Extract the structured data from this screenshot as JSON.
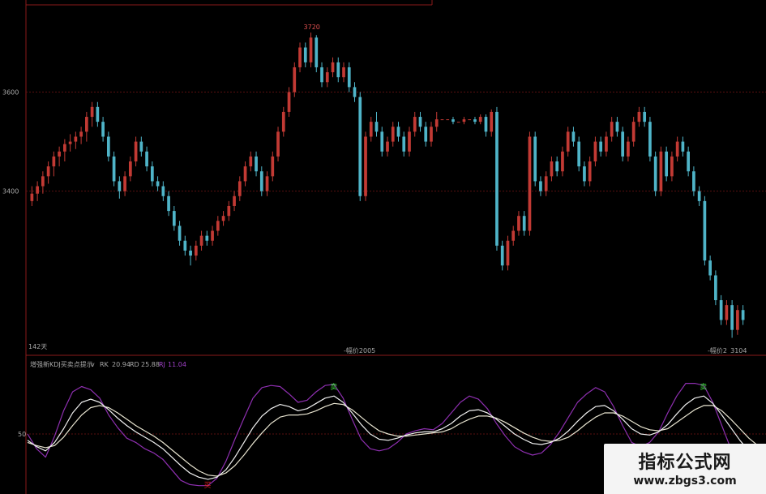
{
  "chart_data": [
    {
      "type": "candlestick",
      "y_ticks": [
        3400,
        3600
      ],
      "ylim": [
        3090,
        3740
      ],
      "high_label": "3720",
      "low_label": "3104",
      "left_label": "142天",
      "bottom_label": "-幅价2005",
      "bottom_right_label": "-幅价2",
      "candles": [
        [
          3380,
          3395,
          3370,
          3410
        ],
        [
          3395,
          3410,
          3380,
          3420
        ],
        [
          3410,
          3430,
          3395,
          3440
        ],
        [
          3430,
          3450,
          3415,
          3460
        ],
        [
          3450,
          3470,
          3430,
          3480
        ],
        [
          3470,
          3480,
          3450,
          3490
        ],
        [
          3480,
          3495,
          3460,
          3505
        ],
        [
          3495,
          3500,
          3480,
          3515
        ],
        [
          3500,
          3510,
          3485,
          3520
        ],
        [
          3510,
          3520,
          3495,
          3530
        ],
        [
          3520,
          3550,
          3500,
          3560
        ],
        [
          3550,
          3570,
          3530,
          3580
        ],
        [
          3570,
          3540,
          3530,
          3580
        ],
        [
          3540,
          3510,
          3500,
          3550
        ],
        [
          3510,
          3470,
          3460,
          3520
        ],
        [
          3470,
          3420,
          3410,
          3480
        ],
        [
          3420,
          3400,
          3385,
          3430
        ],
        [
          3400,
          3430,
          3390,
          3440
        ],
        [
          3430,
          3460,
          3420,
          3470
        ],
        [
          3460,
          3500,
          3450,
          3510
        ],
        [
          3500,
          3480,
          3470,
          3510
        ],
        [
          3480,
          3450,
          3440,
          3490
        ],
        [
          3450,
          3420,
          3410,
          3460
        ],
        [
          3420,
          3410,
          3400,
          3430
        ],
        [
          3410,
          3390,
          3380,
          3420
        ],
        [
          3390,
          3360,
          3350,
          3400
        ],
        [
          3360,
          3330,
          3320,
          3370
        ],
        [
          3330,
          3300,
          3290,
          3340
        ],
        [
          3300,
          3280,
          3270,
          3310
        ],
        [
          3280,
          3270,
          3250,
          3290
        ],
        [
          3270,
          3290,
          3260,
          3300
        ],
        [
          3290,
          3310,
          3280,
          3320
        ],
        [
          3310,
          3300,
          3290,
          3320
        ],
        [
          3300,
          3320,
          3290,
          3330
        ],
        [
          3320,
          3340,
          3310,
          3350
        ],
        [
          3340,
          3350,
          3330,
          3360
        ],
        [
          3350,
          3370,
          3340,
          3380
        ],
        [
          3370,
          3390,
          3360,
          3400
        ],
        [
          3390,
          3420,
          3380,
          3430
        ],
        [
          3420,
          3450,
          3410,
          3460
        ],
        [
          3450,
          3470,
          3440,
          3480
        ],
        [
          3470,
          3440,
          3430,
          3480
        ],
        [
          3440,
          3400,
          3390,
          3450
        ],
        [
          3400,
          3430,
          3390,
          3440
        ],
        [
          3430,
          3470,
          3420,
          3480
        ],
        [
          3470,
          3520,
          3460,
          3530
        ],
        [
          3520,
          3560,
          3510,
          3570
        ],
        [
          3560,
          3600,
          3550,
          3610
        ],
        [
          3600,
          3650,
          3590,
          3660
        ],
        [
          3650,
          3690,
          3640,
          3700
        ],
        [
          3690,
          3660,
          3650,
          3700
        ],
        [
          3660,
          3710,
          3650,
          3720
        ],
        [
          3710,
          3650,
          3640,
          3715
        ],
        [
          3650,
          3620,
          3610,
          3660
        ],
        [
          3620,
          3640,
          3610,
          3650
        ],
        [
          3640,
          3660,
          3630,
          3670
        ],
        [
          3660,
          3630,
          3620,
          3670
        ],
        [
          3630,
          3650,
          3620,
          3660
        ],
        [
          3650,
          3610,
          3600,
          3660
        ],
        [
          3610,
          3590,
          3580,
          3620
        ],
        [
          3590,
          3390,
          3380,
          3600
        ],
        [
          3390,
          3510,
          3380,
          3520
        ],
        [
          3510,
          3540,
          3500,
          3550
        ],
        [
          3540,
          3520,
          3510,
          3560
        ],
        [
          3520,
          3480,
          3470,
          3530
        ],
        [
          3480,
          3500,
          3470,
          3510
        ],
        [
          3500,
          3530,
          3490,
          3540
        ],
        [
          3530,
          3510,
          3500,
          3540
        ],
        [
          3510,
          3480,
          3470,
          3520
        ],
        [
          3480,
          3520,
          3470,
          3530
        ],
        [
          3520,
          3550,
          3510,
          3560
        ],
        [
          3550,
          3530,
          3520,
          3560
        ],
        [
          3530,
          3500,
          3490,
          3540
        ],
        [
          3500,
          3530,
          3490,
          3540
        ],
        [
          3530,
          3545,
          3520,
          3560
        ],
        [
          3545,
          3545,
          3545,
          3545
        ],
        [
          3545,
          3545,
          3545,
          3545
        ],
        [
          3545,
          3540,
          3535,
          3550
        ],
        [
          3540,
          3540,
          3540,
          3540
        ],
        [
          3540,
          3545,
          3535,
          3550
        ],
        [
          3545,
          3545,
          3545,
          3545
        ],
        [
          3545,
          3540,
          3535,
          3550
        ],
        [
          3540,
          3550,
          3535,
          3555
        ],
        [
          3550,
          3520,
          3510,
          3555
        ],
        [
          3520,
          3560,
          3510,
          3565
        ],
        [
          3560,
          3290,
          3280,
          3570
        ],
        [
          3290,
          3250,
          3240,
          3300
        ],
        [
          3250,
          3300,
          3240,
          3310
        ],
        [
          3300,
          3320,
          3290,
          3330
        ],
        [
          3320,
          3350,
          3310,
          3360
        ],
        [
          3350,
          3320,
          3310,
          3360
        ],
        [
          3320,
          3510,
          3310,
          3520
        ],
        [
          3510,
          3420,
          3410,
          3520
        ],
        [
          3420,
          3400,
          3390,
          3430
        ],
        [
          3400,
          3430,
          3390,
          3440
        ],
        [
          3430,
          3460,
          3420,
          3470
        ],
        [
          3460,
          3440,
          3430,
          3470
        ],
        [
          3440,
          3480,
          3430,
          3490
        ],
        [
          3480,
          3520,
          3470,
          3530
        ],
        [
          3520,
          3500,
          3490,
          3530
        ],
        [
          3500,
          3450,
          3440,
          3510
        ],
        [
          3450,
          3420,
          3410,
          3460
        ],
        [
          3420,
          3460,
          3410,
          3470
        ],
        [
          3460,
          3500,
          3450,
          3510
        ],
        [
          3500,
          3480,
          3470,
          3510
        ],
        [
          3480,
          3510,
          3470,
          3520
        ],
        [
          3510,
          3540,
          3500,
          3550
        ],
        [
          3540,
          3520,
          3510,
          3550
        ],
        [
          3520,
          3470,
          3460,
          3530
        ],
        [
          3470,
          3500,
          3460,
          3510
        ],
        [
          3500,
          3540,
          3490,
          3550
        ],
        [
          3540,
          3560,
          3530,
          3570
        ],
        [
          3560,
          3540,
          3530,
          3570
        ],
        [
          3540,
          3470,
          3460,
          3550
        ],
        [
          3470,
          3400,
          3390,
          3480
        ],
        [
          3400,
          3480,
          3390,
          3490
        ],
        [
          3480,
          3430,
          3420,
          3490
        ],
        [
          3430,
          3470,
          3420,
          3480
        ],
        [
          3470,
          3500,
          3460,
          3510
        ],
        [
          3500,
          3480,
          3470,
          3510
        ],
        [
          3480,
          3440,
          3430,
          3490
        ],
        [
          3440,
          3400,
          3390,
          3450
        ],
        [
          3400,
          3380,
          3370,
          3410
        ],
        [
          3380,
          3260,
          3250,
          3390
        ],
        [
          3260,
          3230,
          3220,
          3270
        ],
        [
          3230,
          3180,
          3170,
          3240
        ],
        [
          3180,
          3140,
          3130,
          3190
        ],
        [
          3140,
          3170,
          3130,
          3180
        ],
        [
          3170,
          3120,
          3104,
          3180
        ],
        [
          3120,
          3160,
          3110,
          3170
        ],
        [
          3160,
          3140,
          3130,
          3170
        ]
      ]
    },
    {
      "type": "line",
      "header_title": "增强新KDJ买卖点提示",
      "header_arrow": "v",
      "series_labels": [
        {
          "name": "RK",
          "value": "20.94",
          "color": "#d8d8d8"
        },
        {
          "name": "RD",
          "value": "25.88",
          "color": "#d8d8d8"
        },
        {
          "name": "RJ",
          "value": "11.04",
          "color": "#a040c8"
        }
      ],
      "y_tick_label": "50",
      "ylim": [
        0,
        100
      ],
      "colors": {
        "RK": "#f0f0f0",
        "RD": "#e8e4d0",
        "RJ": "#8e2fb0"
      },
      "series": [
        {
          "name": "RK",
          "values": [
            44,
            38,
            34,
            42,
            55,
            70,
            80,
            83,
            80,
            73,
            65,
            58,
            52,
            47,
            42,
            36,
            28,
            20,
            13,
            9,
            7,
            9,
            16,
            28,
            42,
            56,
            67,
            74,
            78,
            76,
            72,
            74,
            79,
            84,
            86,
            80,
            70,
            59,
            50,
            45,
            44,
            46,
            49,
            51,
            52,
            52,
            55,
            60,
            67,
            72,
            73,
            70,
            64,
            57,
            50,
            45,
            41,
            40,
            42,
            46,
            53,
            62,
            70,
            76,
            77,
            72,
            64,
            55,
            50,
            49,
            52,
            59,
            69,
            78,
            84,
            86,
            79,
            68,
            56,
            44,
            34,
            28
          ]
        },
        {
          "name": "RD",
          "values": [
            42,
            39,
            37,
            39,
            47,
            58,
            68,
            75,
            77,
            75,
            70,
            64,
            58,
            53,
            48,
            42,
            35,
            28,
            21,
            15,
            11,
            10,
            13,
            20,
            30,
            41,
            51,
            60,
            66,
            68,
            68,
            69,
            72,
            76,
            79,
            78,
            73,
            66,
            59,
            53,
            50,
            48,
            48,
            49,
            50,
            51,
            52,
            55,
            60,
            64,
            67,
            67,
            65,
            61,
            56,
            51,
            47,
            44,
            43,
            44,
            47,
            53,
            60,
            66,
            70,
            70,
            67,
            62,
            57,
            54,
            53,
            55,
            61,
            67,
            73,
            77,
            77,
            72,
            64,
            55,
            46,
            39
          ]
        },
        {
          "name": "RJ",
          "values": [
            50,
            36,
            28,
            48,
            72,
            90,
            95,
            92,
            84,
            68,
            56,
            46,
            42,
            36,
            32,
            26,
            16,
            6,
            2,
            1,
            1,
            8,
            24,
            45,
            65,
            84,
            94,
            96,
            95,
            88,
            80,
            82,
            90,
            96,
            97,
            84,
            64,
            45,
            36,
            34,
            36,
            42,
            50,
            53,
            55,
            54,
            60,
            70,
            80,
            86,
            83,
            74,
            60,
            48,
            38,
            33,
            30,
            32,
            40,
            52,
            66,
            80,
            88,
            94,
            90,
            76,
            58,
            42,
            38,
            42,
            52,
            70,
            86,
            98,
            98,
            96,
            80,
            58,
            36,
            22,
            12,
            8
          ]
        }
      ],
      "markers": [
        {
          "type": "sell",
          "symbol": "卖",
          "color": "#3ad03a"
        },
        {
          "type": "sell",
          "symbol": "卖",
          "color": "#3ad03a"
        },
        {
          "type": "buy",
          "symbol": "买",
          "color": "#e02020"
        }
      ]
    }
  ],
  "watermark": {
    "cn": "指标公式网",
    "url": "www.zbgs3.com"
  },
  "colors": {
    "up": "#c23a34",
    "down": "#4fb4c8",
    "frame": "#8a1a1a",
    "grid": "#5a1010",
    "text": "#a8a8a8"
  }
}
